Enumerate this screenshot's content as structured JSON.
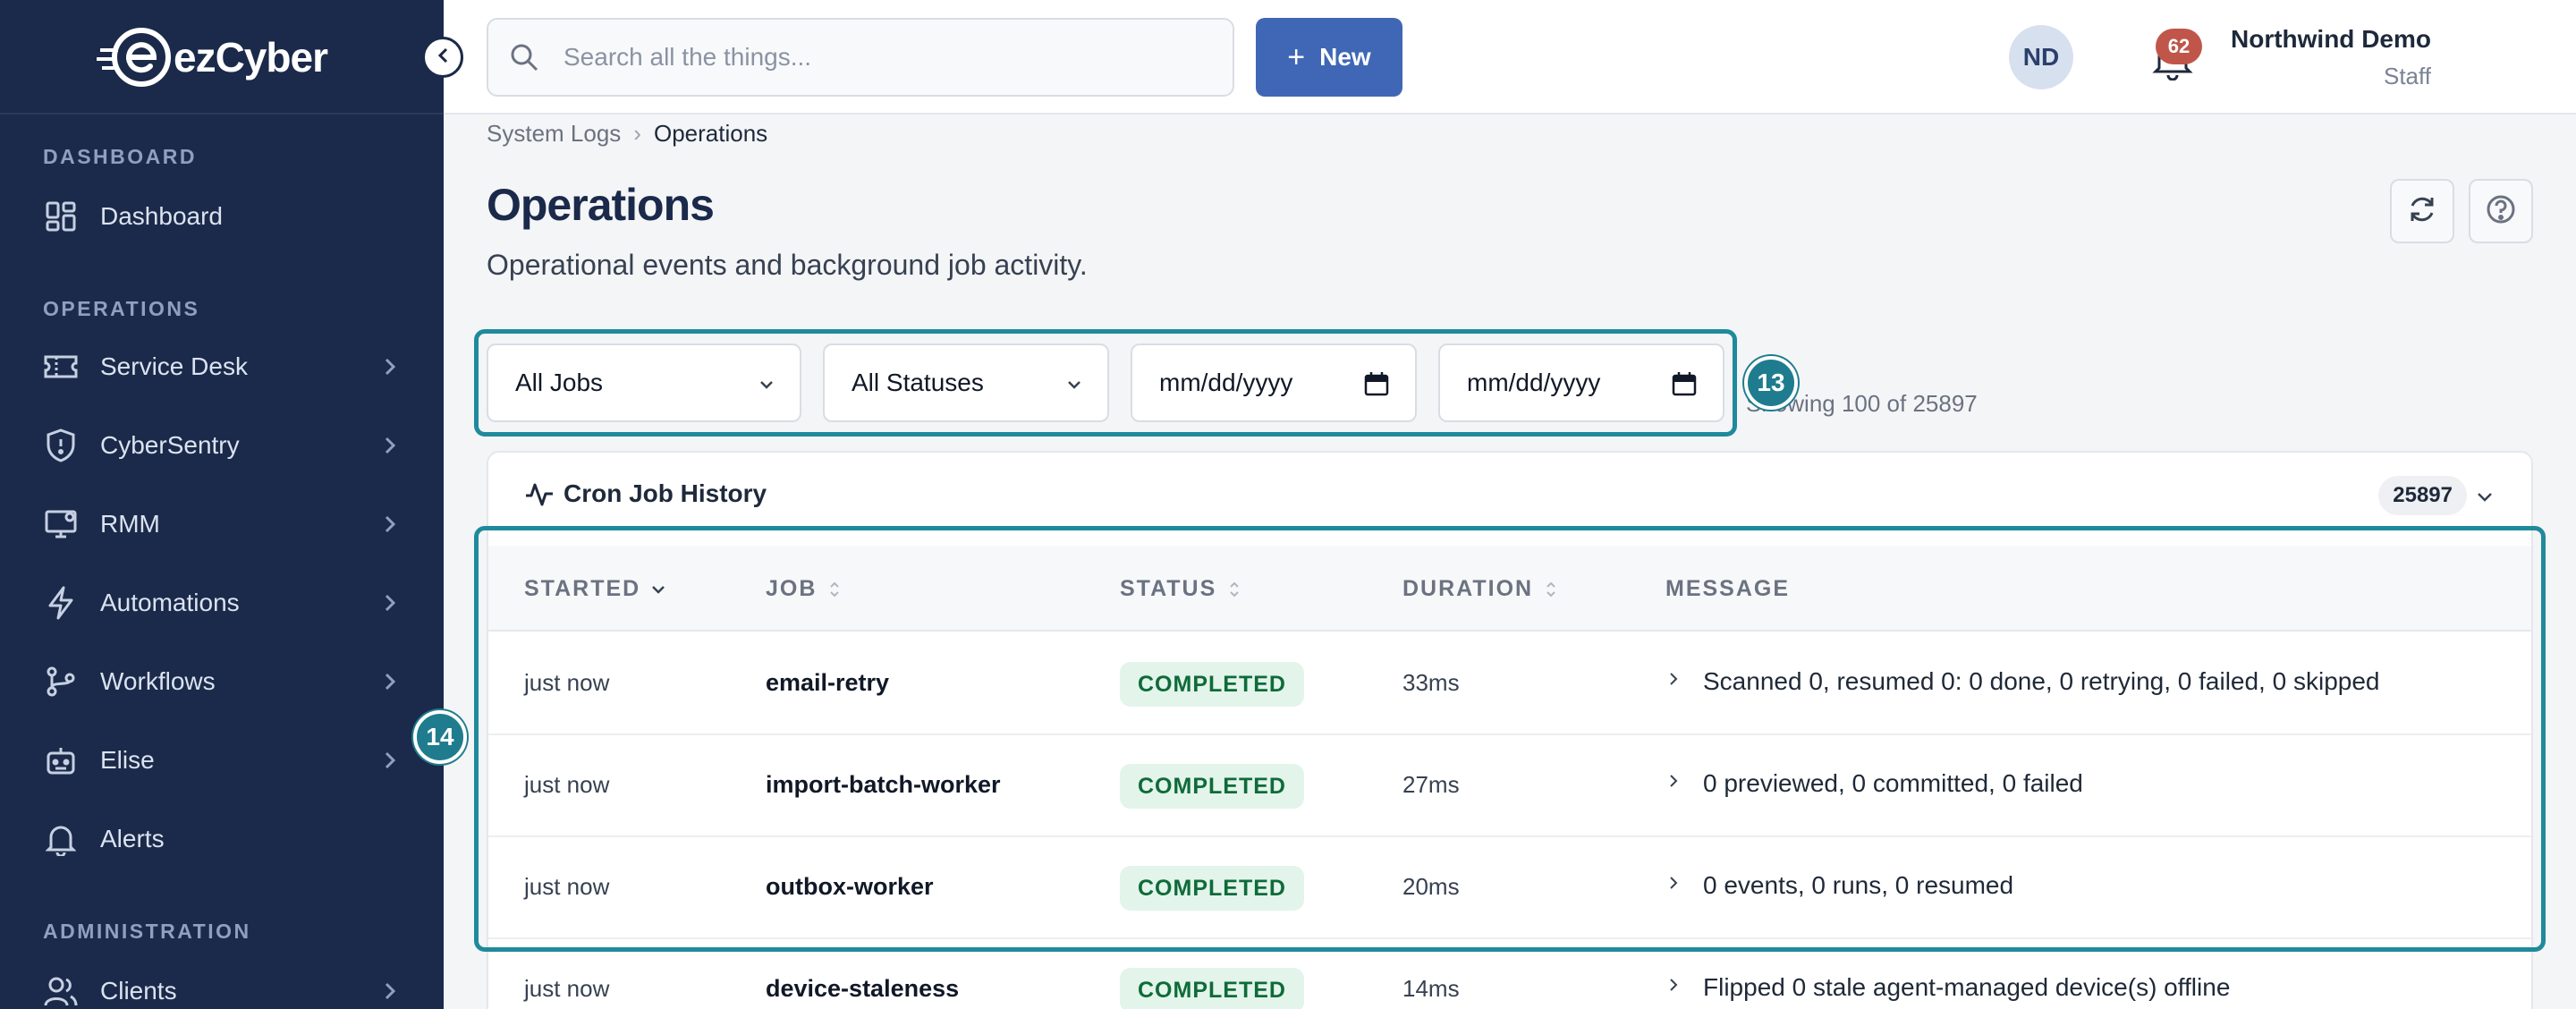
{
  "brand": {
    "name": "ezCyber"
  },
  "sidebar": {
    "sections": [
      {
        "label": "DASHBOARD"
      },
      {
        "label": "OPERATIONS"
      },
      {
        "label": "ADMINISTRATION"
      }
    ],
    "items": [
      {
        "label": "Dashboard",
        "icon": "dashboard-grid-icon"
      },
      {
        "label": "Service Desk",
        "icon": "ticket-icon"
      },
      {
        "label": "CyberSentry",
        "icon": "shield-icon"
      },
      {
        "label": "RMM",
        "icon": "monitor-icon"
      },
      {
        "label": "Automations",
        "icon": "lightning-icon"
      },
      {
        "label": "Workflows",
        "icon": "branch-icon"
      },
      {
        "label": "Elise",
        "icon": "robot-icon"
      },
      {
        "label": "Alerts",
        "icon": "bell-icon"
      },
      {
        "label": "Clients",
        "icon": "users-icon"
      }
    ]
  },
  "topbar": {
    "search_placeholder": "Search all the things...",
    "new_label": "New",
    "notifications_count": "62",
    "user_name": "Northwind Demo",
    "user_role": "Staff",
    "avatar_initials": "ND"
  },
  "breadcrumb": [
    "System Logs",
    "Operations"
  ],
  "page": {
    "title": "Operations",
    "subtitle": "Operational events and background job activity."
  },
  "filters": {
    "job": "All Jobs",
    "status": "All Statuses",
    "date_from": "mm/dd/yyyy",
    "date_to": "mm/dd/yyyy",
    "showing": "Showing 100 of 25897"
  },
  "markers": {
    "filters": "13",
    "table": "14"
  },
  "card": {
    "title": "Cron Job History",
    "count": "25897"
  },
  "table": {
    "columns": [
      "STARTED",
      "JOB",
      "STATUS",
      "DURATION",
      "MESSAGE"
    ],
    "rows": [
      {
        "started": "just now",
        "job": "email-retry",
        "status": "COMPLETED",
        "duration": "33ms",
        "message": "Scanned 0, resumed 0: 0 done, 0 retrying, 0 failed, 0 skipped"
      },
      {
        "started": "just now",
        "job": "import-batch-worker",
        "status": "COMPLETED",
        "duration": "27ms",
        "message": "0 previewed, 0 committed, 0 failed"
      },
      {
        "started": "just now",
        "job": "outbox-worker",
        "status": "COMPLETED",
        "duration": "20ms",
        "message": "0 events, 0 runs, 0 resumed"
      },
      {
        "started": "just now",
        "job": "device-staleness",
        "status": "COMPLETED",
        "duration": "14ms",
        "message": "Flipped 0 stale agent-managed device(s) offline"
      }
    ]
  },
  "colors": {
    "sidebar_bg": "#1b2a4a",
    "accent": "#3f67b5",
    "highlight": "#1f8a9c",
    "status_completed": "#0e6b3a"
  }
}
